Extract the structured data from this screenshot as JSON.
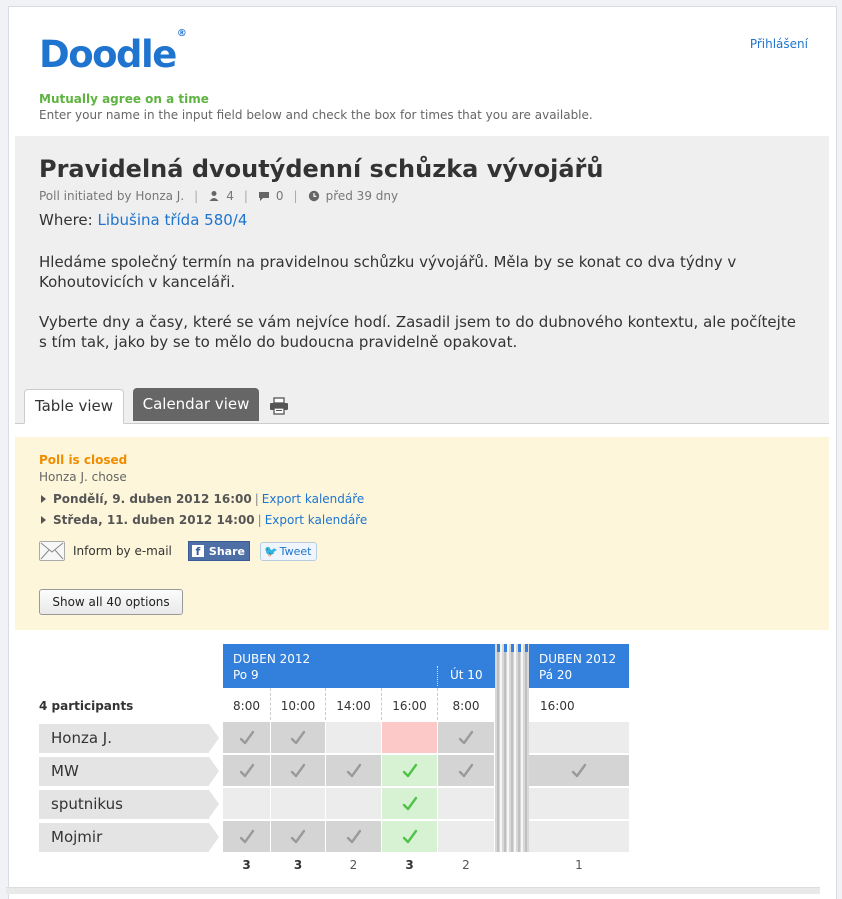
{
  "logo": {
    "text": "Doodle",
    "mark": "®"
  },
  "header": {
    "login_label": "Přihlášení"
  },
  "intro": {
    "tagline": "Mutually agree on a time",
    "subtitle": "Enter your name in the input field below and check the box for times that you are available."
  },
  "poll": {
    "title": "Pravidelná dvoutýdenní schůzka vývojářů",
    "initiated": "Poll initiated by Honza J.",
    "participants_count": "4",
    "comments_count": "0",
    "age": "před 39 dny",
    "where_label": "Where:",
    "where_value": "Libušina třída 580/4",
    "description": [
      "Hledáme společný termín na pravidelnou schůzku vývojářů. Měla by se konat co dva týdny v Kohoutovicích v kanceláři.",
      "Vyberte dny a časy, které se vám nejvíce hodí. Zasadil jsem to do dubnového kontextu, ale počítejte s tím tak, jako by se to mělo do budoucna pravidelně opakovat."
    ]
  },
  "tabs": {
    "table": "Table view",
    "calendar": "Calendar view"
  },
  "status": {
    "closed": "Poll is closed",
    "chose": "Honza J. chose",
    "options": [
      {
        "date": "Pondělí, 9. duben 2012 16:00",
        "export": "Export kalendáře"
      },
      {
        "date": "Středa, 11. duben 2012 14:00",
        "export": "Export kalendáře"
      }
    ],
    "inform": "Inform by e-mail",
    "share": "Share",
    "tweet": "Tweet",
    "show_all": "Show all 40 options"
  },
  "table": {
    "month1": "DUBEN 2012",
    "day1": "Po 9",
    "day2": "Út 10",
    "month2": "DUBEN 2012",
    "day3": "Pá 20",
    "participants_label": "4 participants",
    "times": [
      "8:00",
      "10:00",
      "14:00",
      "16:00",
      "8:00",
      "16:00"
    ],
    "participants": [
      {
        "name": "Honza J.",
        "votes": [
          1,
          1,
          0,
          0,
          1,
          0
        ]
      },
      {
        "name": "MW",
        "votes": [
          1,
          1,
          1,
          1,
          1,
          1
        ]
      },
      {
        "name": "sputnikus",
        "votes": [
          0,
          0,
          0,
          1,
          0,
          0
        ]
      },
      {
        "name": "Mojmir",
        "votes": [
          1,
          1,
          1,
          1,
          0,
          0
        ]
      }
    ],
    "sums": [
      "3",
      "3",
      "2",
      "3",
      "2",
      "1"
    ]
  },
  "colors": {
    "brand": "#1e74cf",
    "header_blue": "#3380dc",
    "yes": "#d4d4d4",
    "winner": "#d6f2d2",
    "winner_no": "#fcc8c8",
    "tagline_green": "#5fb340",
    "closed_orange": "#f08c00"
  }
}
